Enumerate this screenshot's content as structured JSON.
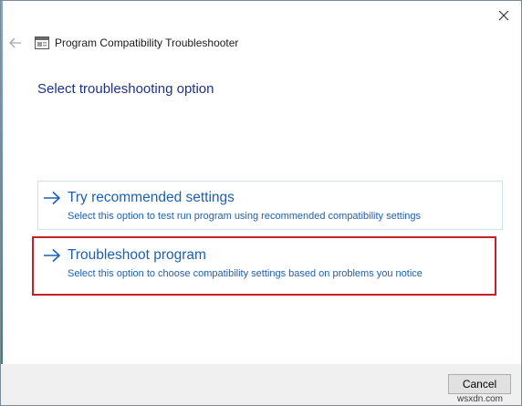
{
  "window": {
    "title": "Program Compatibility Troubleshooter"
  },
  "icons": {
    "back": "back-arrow-icon",
    "close": "close-icon",
    "app": "troubleshooter-icon",
    "option_arrow": "right-arrow-icon"
  },
  "page": {
    "heading": "Select troubleshooting option"
  },
  "options": [
    {
      "title": "Try recommended settings",
      "description": "Select this option to test run program using recommended compatibility settings"
    },
    {
      "title": "Troubleshoot program",
      "description": "Select this option to choose compatibility settings based on problems you notice"
    }
  ],
  "footer": {
    "cancel_label": "Cancel"
  },
  "watermark": "wsxdn.com",
  "colors": {
    "heading": "#1e3287",
    "link": "#1d5fb2",
    "highlight": "#c8202a",
    "footer_bg": "#f0f0f0"
  }
}
